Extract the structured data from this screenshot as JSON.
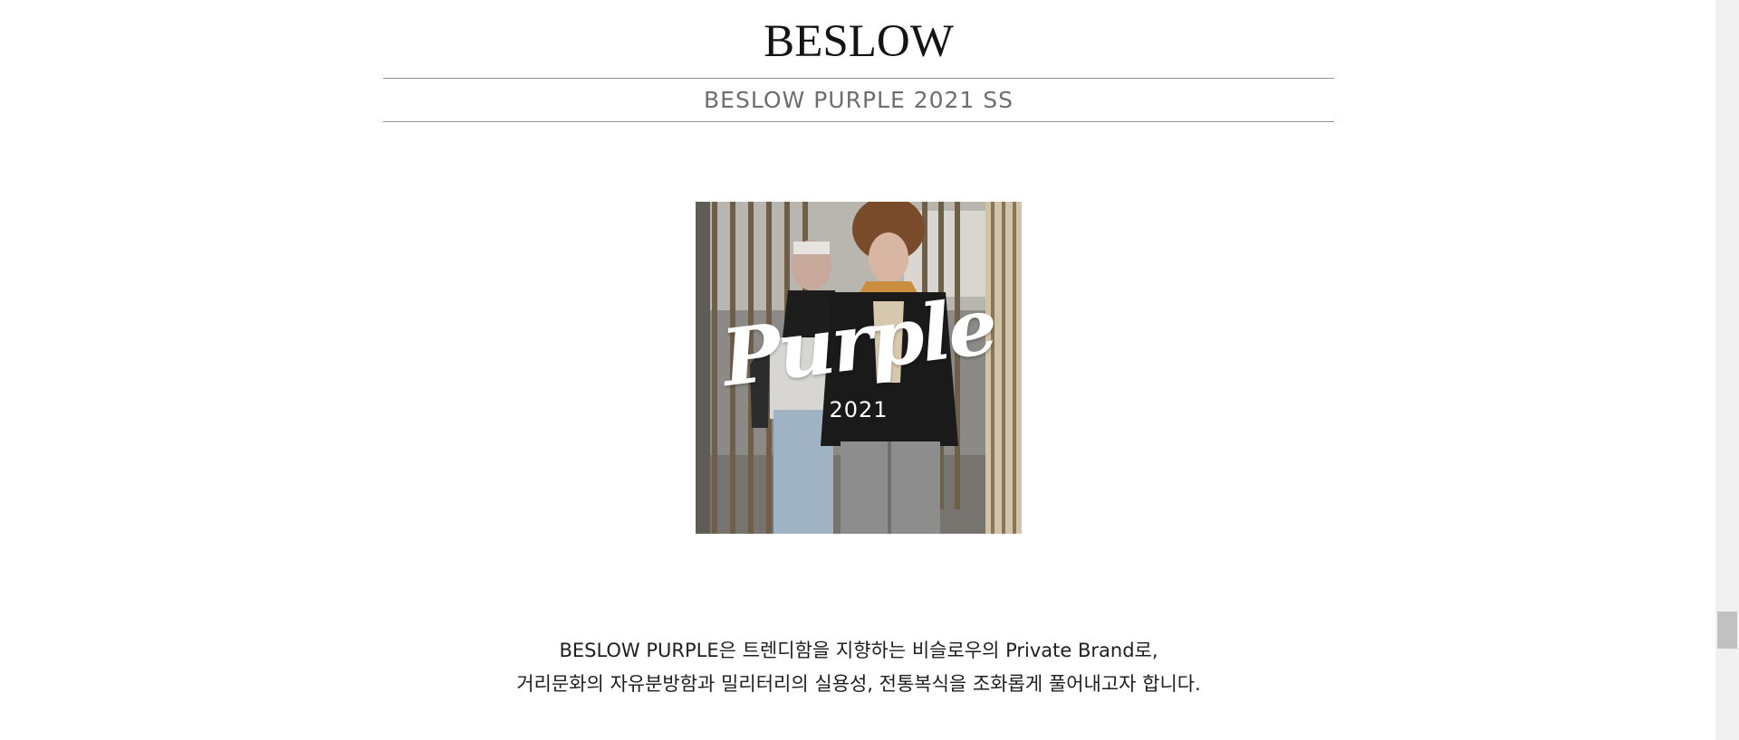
{
  "header": {
    "logo": "BESLOW",
    "subtitle": "BESLOW PURPLE 2021 SS"
  },
  "hero": {
    "brand_text": "Purple",
    "year_text": "2021"
  },
  "description": {
    "line1": "BESLOW PURPLE은 트렌디함을 지향하는 비슬로우의 Private Brand로,",
    "line2": "거리문화의 자유분방함과 밀리터리의 실용성, 전통복식을 조화롭게 풀어내고자 합니다."
  },
  "colors": {
    "background": "#ffffff",
    "rule": "#8f8f8f",
    "subtitle_text": "#6e6e6e",
    "body_text": "#1e1e1e"
  }
}
